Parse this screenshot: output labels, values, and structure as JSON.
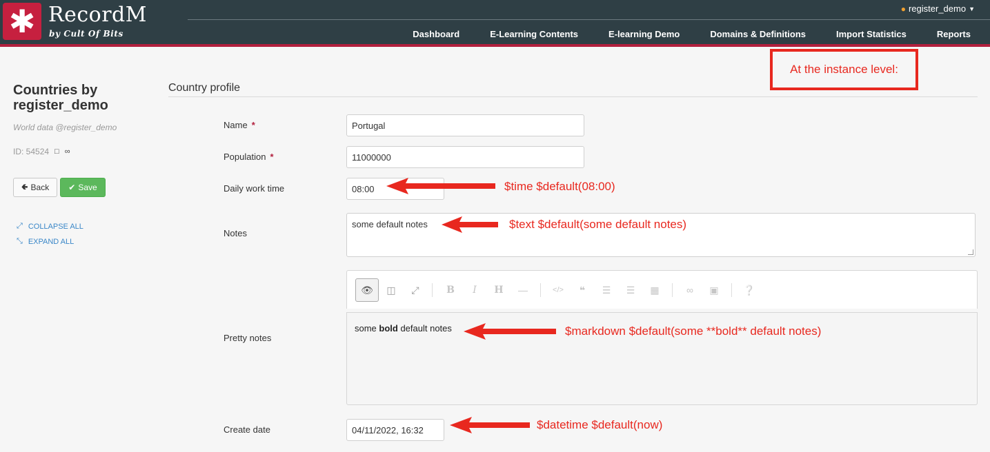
{
  "header": {
    "brand": "RecordM",
    "brand_sub": "by Cult Of Bits",
    "user": "register_demo",
    "nav": [
      "Dashboard",
      "E-Learning Contents",
      "E-learning Demo",
      "Domains & Definitions",
      "Import Statistics",
      "Reports"
    ]
  },
  "sidebar": {
    "title": "Countries by register_demo",
    "subtitle": "World data @register_demo",
    "id_label": "ID: 54524",
    "back_label": "Back",
    "save_label": "Save",
    "collapse_label": "COLLAPSE ALL",
    "expand_label": "EXPAND ALL"
  },
  "form": {
    "section_title": "Country profile",
    "name_label": "Name",
    "name_value": "Portugal",
    "population_label": "Population",
    "population_value": "11000000",
    "required_mark": "*",
    "work_time_label": "Daily work time",
    "work_time_value": "08:00",
    "notes_label": "Notes",
    "notes_value": "some default notes",
    "pretty_notes_label": "Pretty notes",
    "pretty_pre": "some ",
    "pretty_bold": "bold",
    "pretty_post": " default notes",
    "create_date_label": "Create date",
    "create_date_value": "04/11/2022, 16:32"
  },
  "annotations": {
    "box": "At the instance level:",
    "time": "$time $default(08:00)",
    "text": "$text $default(some default notes)",
    "markdown": "$markdown $default(some **bold** default notes)",
    "datetime": "$datetime $default(now)"
  },
  "toolbar_icons": [
    "eye-icon",
    "columns-icon",
    "fullscreen-icon",
    "bold-icon",
    "italic-icon",
    "heading-icon",
    "horizontal-rule-icon",
    "code-icon",
    "quote-icon",
    "unordered-list-icon",
    "ordered-list-icon",
    "table-icon",
    "link-icon",
    "image-icon",
    "help-icon"
  ],
  "colors": {
    "header_bg": "#2f3f45",
    "accent": "#b21f3d",
    "annotation": "#e8281f",
    "save": "#5cb85c",
    "link": "#3a87c8"
  }
}
